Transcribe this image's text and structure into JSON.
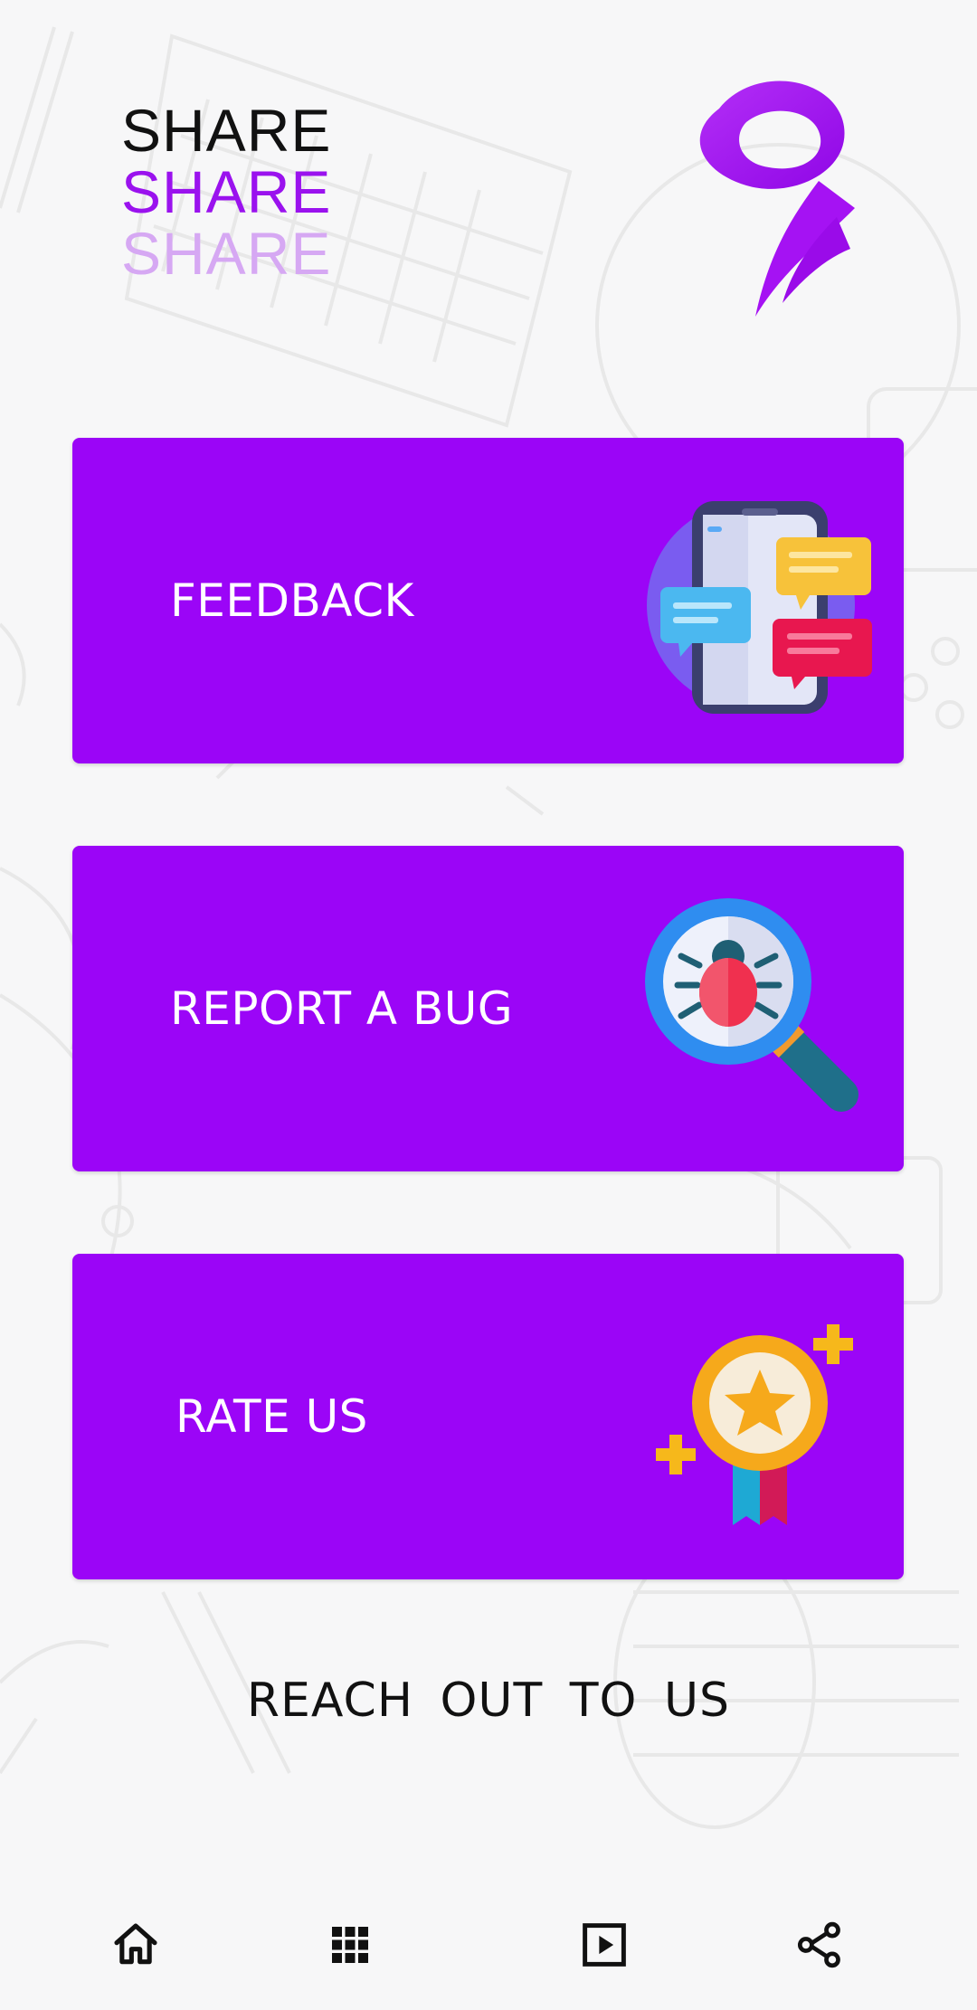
{
  "brand": {
    "lines": [
      "SHARE",
      "SHARE",
      "SHARE"
    ]
  },
  "cards": [
    {
      "label": "FEEDBACK",
      "icon": "chat-phone-icon"
    },
    {
      "label": "REPORT A BUG",
      "icon": "bug-magnifier-icon"
    },
    {
      "label": "RATE US",
      "icon": "star-medal-icon"
    }
  ],
  "footer": {
    "reach_text": "REACH  OUT  TO  US"
  },
  "bottom_nav": [
    {
      "name": "home",
      "icon": "home-icon"
    },
    {
      "name": "apps",
      "icon": "grid-icon"
    },
    {
      "name": "play",
      "icon": "play-icon"
    },
    {
      "name": "share",
      "icon": "share-icon"
    }
  ],
  "colors": {
    "accent": "#9b05f7",
    "brand_mid": "#9a12ee",
    "brand_light": "#d6a8f3",
    "background": "#f7f7f8"
  }
}
